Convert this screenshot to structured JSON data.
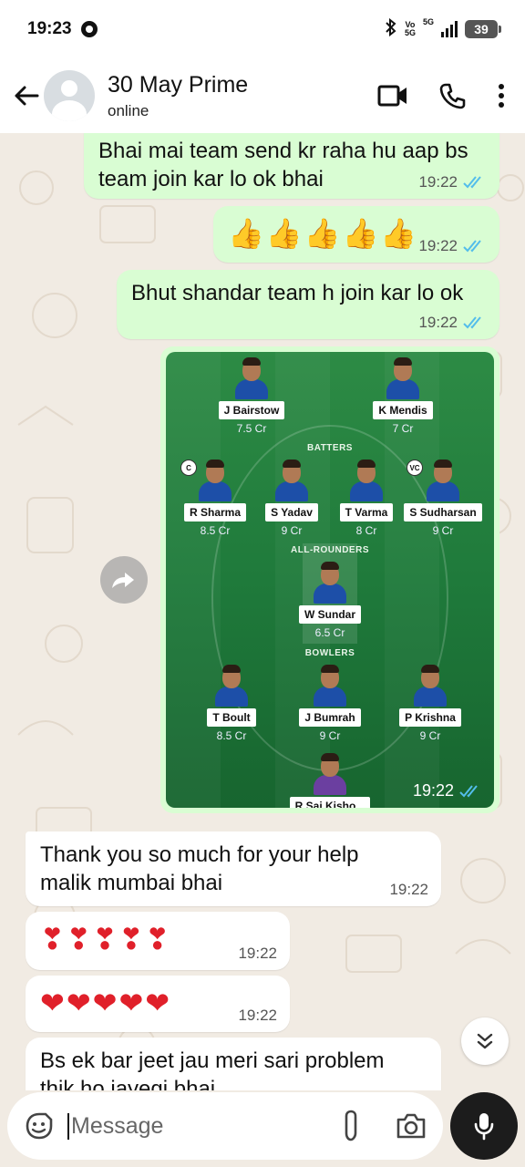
{
  "status_bar": {
    "time": "19:23",
    "network_top": "Vo",
    "network_bottom": "5G",
    "network_type": "5G",
    "battery": "39"
  },
  "header": {
    "contact_name": "30 May Prime",
    "contact_status": "online"
  },
  "messages": [
    {
      "type": "text",
      "direction": "out",
      "text": "Bhai mai team send kr raha hu aap bs team join kar lo ok bhai",
      "time": "19:22",
      "read": true
    },
    {
      "type": "emoji",
      "direction": "out",
      "text": "👍👍👍👍👍",
      "time": "19:22",
      "read": true
    },
    {
      "type": "text",
      "direction": "out",
      "text": "Bhut shandar team h join kar lo ok",
      "time": "19:22",
      "read": true
    },
    {
      "type": "image",
      "direction": "out",
      "time": "19:22",
      "read": true
    },
    {
      "type": "text",
      "direction": "in",
      "text": "Thank you so much for your help malik mumbai bhai",
      "time": "19:22"
    },
    {
      "type": "emoji",
      "direction": "in",
      "text": "❣❣❣❣❣",
      "time": "19:22"
    },
    {
      "type": "emoji",
      "direction": "in",
      "text": "❤❤❤❤❤",
      "time": "19:22"
    },
    {
      "type": "text",
      "direction": "in",
      "text": "Bs ek bar jeet jau meri sari problem thik ho jayegi bhai"
    }
  ],
  "team_image": {
    "sections": {
      "batters": "BATTERS",
      "allrounders": "ALL-ROUNDERS",
      "bowlers": "BOWLERS"
    },
    "players": [
      {
        "name": "J Bairstow",
        "credit": "7.5 Cr"
      },
      {
        "name": "K Mendis",
        "credit": "7 Cr"
      },
      {
        "name": "R Sharma",
        "credit": "8.5 Cr",
        "badge": "C"
      },
      {
        "name": "S Yadav",
        "credit": "9 Cr"
      },
      {
        "name": "T Varma",
        "credit": "8 Cr"
      },
      {
        "name": "S Sudharsan",
        "credit": "9 Cr",
        "badge": "VC"
      },
      {
        "name": "W Sundar",
        "credit": "6.5 Cr"
      },
      {
        "name": "T Boult",
        "credit": "8.5 Cr"
      },
      {
        "name": "J Bumrah",
        "credit": "9 Cr"
      },
      {
        "name": "P Krishna",
        "credit": "9 Cr"
      },
      {
        "name": "R Sai Kisho...",
        "credit": ""
      }
    ]
  },
  "composer": {
    "placeholder": "Message"
  },
  "colors": {
    "outgoing_bubble": "#d9fdd3",
    "incoming_bubble": "#ffffff",
    "read_ticks": "#53bdeb",
    "wallpaper": "#f1ebe3",
    "mic_button": "#1c1c1c"
  },
  "icons": {
    "back": "arrow-left-icon",
    "video": "video-camera-icon",
    "call": "phone-icon",
    "menu": "more-vertical-icon",
    "emoji": "emoji-icon",
    "attach": "paperclip-icon",
    "camera": "camera-icon",
    "mic": "microphone-icon",
    "forward": "forward-icon",
    "scroll": "double-chevron-down-icon"
  }
}
